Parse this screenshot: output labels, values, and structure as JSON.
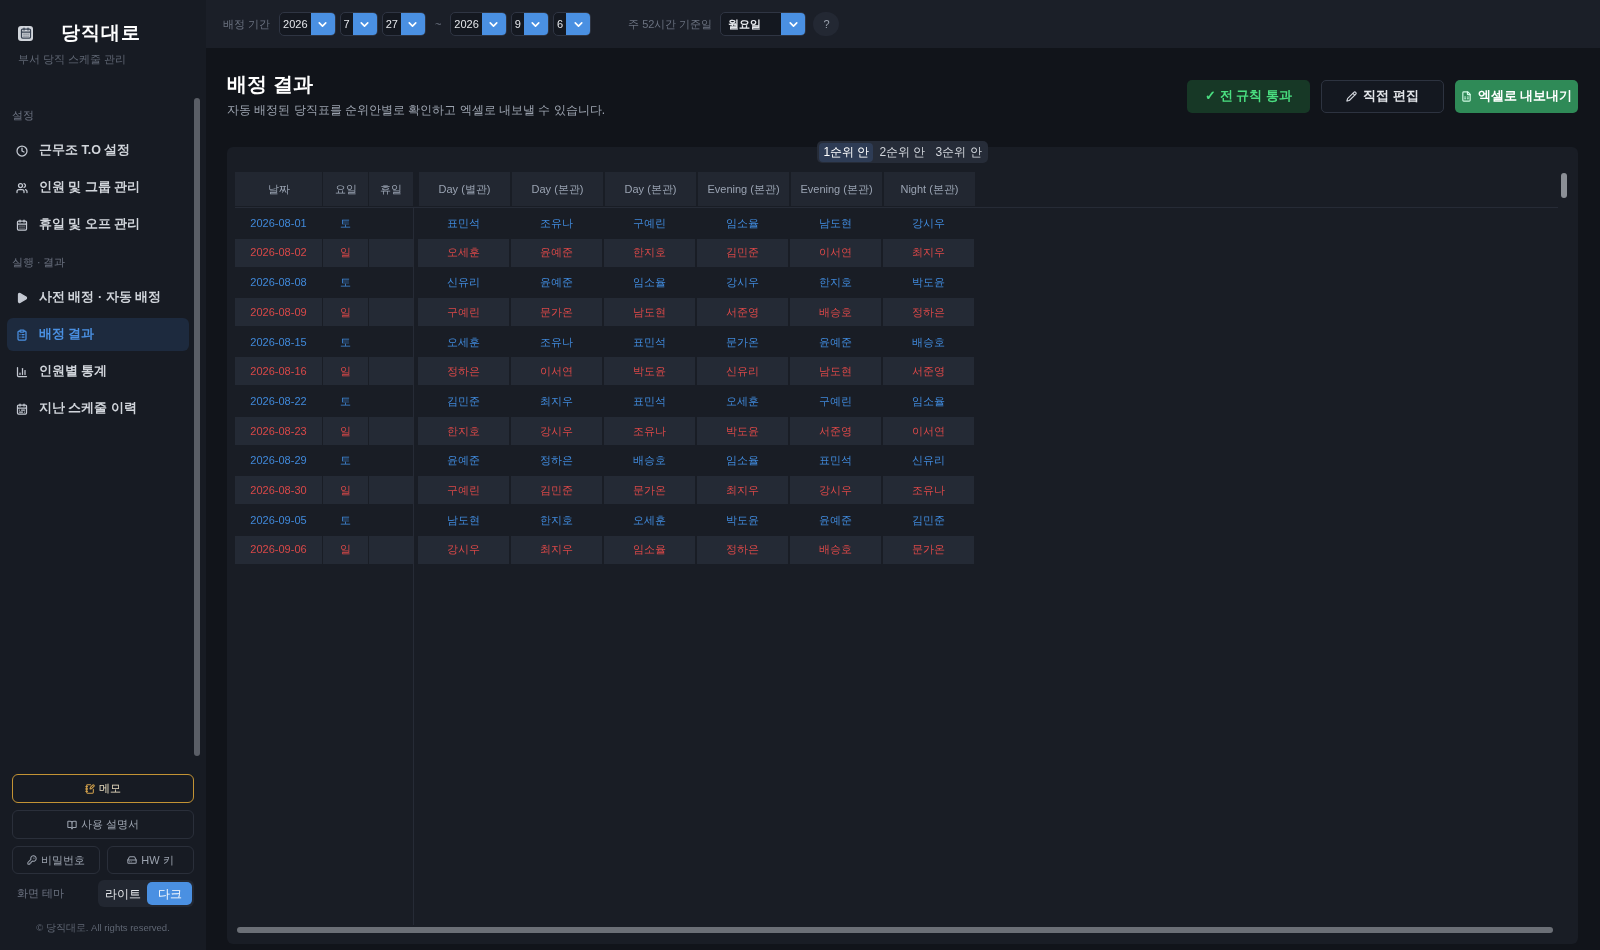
{
  "sidebar": {
    "title": "당직대로",
    "subtitle": "부서 당직 스케줄 관리",
    "sections": [
      {
        "label": "설정",
        "items": [
          {
            "label": "근무조 T.O 설정",
            "selected": false
          },
          {
            "label": "인원 및 그룹 관리",
            "selected": false
          },
          {
            "label": "휴일 및 오프 관리",
            "selected": false
          }
        ]
      },
      {
        "label": "실행 · 결과",
        "items": [
          {
            "label": "사전 배정 · 자동 배정",
            "selected": false
          },
          {
            "label": "배정 결과",
            "selected": true
          },
          {
            "label": "인원별 통계",
            "selected": false
          },
          {
            "label": "지난 스케줄 이력",
            "selected": false
          }
        ]
      }
    ],
    "memo_button": "메모",
    "manual_button": "사용 설명서",
    "password_button": "비밀번호",
    "hw_key_button": "HW 키",
    "theme": {
      "label": "화면 테마",
      "options": [
        {
          "label": "라이트",
          "selected": false
        },
        {
          "label": "다크",
          "selected": true
        }
      ]
    },
    "copyright": "© 당직대로. All rights reserved."
  },
  "toolbar": {
    "period_label": "배정 기간",
    "start": [
      "2026",
      "7",
      "27"
    ],
    "separator": "~",
    "end": [
      "2026",
      "9",
      "6"
    ],
    "week_basis_label": "주 52시간 기준일",
    "week_basis": "월요일",
    "help": "?"
  },
  "header": {
    "title": "배정 결과",
    "description": "자동 배정된 당직표를 순위안별로 확인하고 엑셀로 내보낼 수 있습니다.",
    "buttons": [
      {
        "kind": "status",
        "label": "✓ 전 규칙 통과"
      },
      {
        "kind": "edit",
        "label": "직접 편집"
      },
      {
        "kind": "export",
        "label": "엑셀로 내보내기"
      }
    ]
  },
  "plan_tabs": [
    {
      "label": "1순위 안",
      "selected": true
    },
    {
      "label": "2순위 안",
      "selected": false
    },
    {
      "label": "3순위 안",
      "selected": false
    }
  ],
  "table": {
    "columns": [
      "날짜",
      "요일",
      "휴일",
      "Day (별관)",
      "Day (본관)",
      "Day (본관)",
      "Evening (본관)",
      "Evening (본관)",
      "Night (본관)"
    ],
    "rows": [
      {
        "kind": "sat",
        "date": "2026-08-01",
        "weekday": "토",
        "shifts": [
          "표민석",
          "조유나",
          "구예린",
          "임소율",
          "남도현",
          "강시우"
        ]
      },
      {
        "kind": "sun",
        "date": "2026-08-02",
        "weekday": "일",
        "shifts": [
          "오세훈",
          "윤예준",
          "한지호",
          "김민준",
          "이서연",
          "최지우"
        ]
      },
      {
        "kind": "sat",
        "date": "2026-08-08",
        "weekday": "토",
        "shifts": [
          "신유리",
          "윤예준",
          "임소율",
          "강시우",
          "한지호",
          "박도윤"
        ]
      },
      {
        "kind": "sun",
        "date": "2026-08-09",
        "weekday": "일",
        "shifts": [
          "구예린",
          "문가온",
          "남도현",
          "서준영",
          "배승호",
          "정하은"
        ]
      },
      {
        "kind": "sat",
        "date": "2026-08-15",
        "weekday": "토",
        "shifts": [
          "오세훈",
          "조유나",
          "표민석",
          "문가온",
          "윤예준",
          "배승호"
        ]
      },
      {
        "kind": "sun",
        "date": "2026-08-16",
        "weekday": "일",
        "shifts": [
          "정하은",
          "이서연",
          "박도윤",
          "신유리",
          "남도현",
          "서준영"
        ]
      },
      {
        "kind": "sat",
        "date": "2026-08-22",
        "weekday": "토",
        "shifts": [
          "김민준",
          "최지우",
          "표민석",
          "오세훈",
          "구예린",
          "임소율"
        ]
      },
      {
        "kind": "sun",
        "date": "2026-08-23",
        "weekday": "일",
        "shifts": [
          "한지호",
          "강시우",
          "조유나",
          "박도윤",
          "서준영",
          "이서연"
        ]
      },
      {
        "kind": "sat",
        "date": "2026-08-29",
        "weekday": "토",
        "shifts": [
          "윤예준",
          "정하은",
          "배승호",
          "임소율",
          "표민석",
          "신유리"
        ]
      },
      {
        "kind": "sun",
        "date": "2026-08-30",
        "weekday": "일",
        "shifts": [
          "구예린",
          "김민준",
          "문가온",
          "최지우",
          "강시우",
          "조유나"
        ]
      },
      {
        "kind": "sat",
        "date": "2026-09-05",
        "weekday": "토",
        "shifts": [
          "남도현",
          "한지호",
          "오세훈",
          "박도윤",
          "윤예준",
          "김민준"
        ]
      },
      {
        "kind": "sun",
        "date": "2026-09-06",
        "weekday": "일",
        "shifts": [
          "강시우",
          "최지우",
          "임소율",
          "정하은",
          "배승호",
          "문가온"
        ]
      }
    ]
  }
}
